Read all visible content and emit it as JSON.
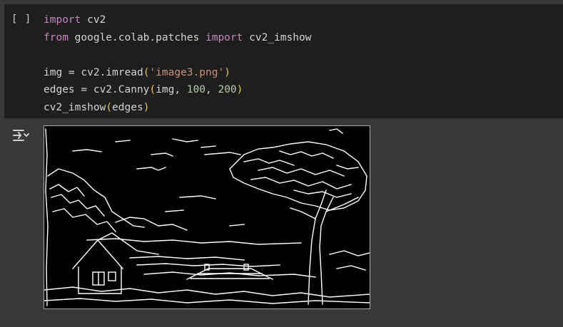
{
  "cell": {
    "run_label": "[ ]",
    "code": {
      "line1_kw": "import",
      "line1_rest": " cv2",
      "line2_kw1": "from",
      "line2_mid": " google.colab.patches ",
      "line2_kw2": "import",
      "line2_rest": " cv2_imshow",
      "line4_pre": "img = cv2.imread",
      "line4_open": "(",
      "line4_str": "'image3.png'",
      "line4_close": ")",
      "line5_pre": "edges = cv2.Canny",
      "line5_open": "(",
      "line5_mid": "img, ",
      "line5_num1": "100",
      "line5_sep": ", ",
      "line5_num2": "200",
      "line5_close": ")",
      "line6_pre": "cv2_imshow",
      "line6_open": "(",
      "line6_mid": "edges",
      "line6_close": ")"
    }
  },
  "output": {
    "icon": "output-actions-icon",
    "image": "canny-edge-output-image"
  },
  "colors": {
    "background": "#383838",
    "cell_bg": "#1e1e1e",
    "keyword": "#c586c0",
    "string": "#ce9178",
    "number": "#b5cea8",
    "paren": "#e8c84a"
  }
}
